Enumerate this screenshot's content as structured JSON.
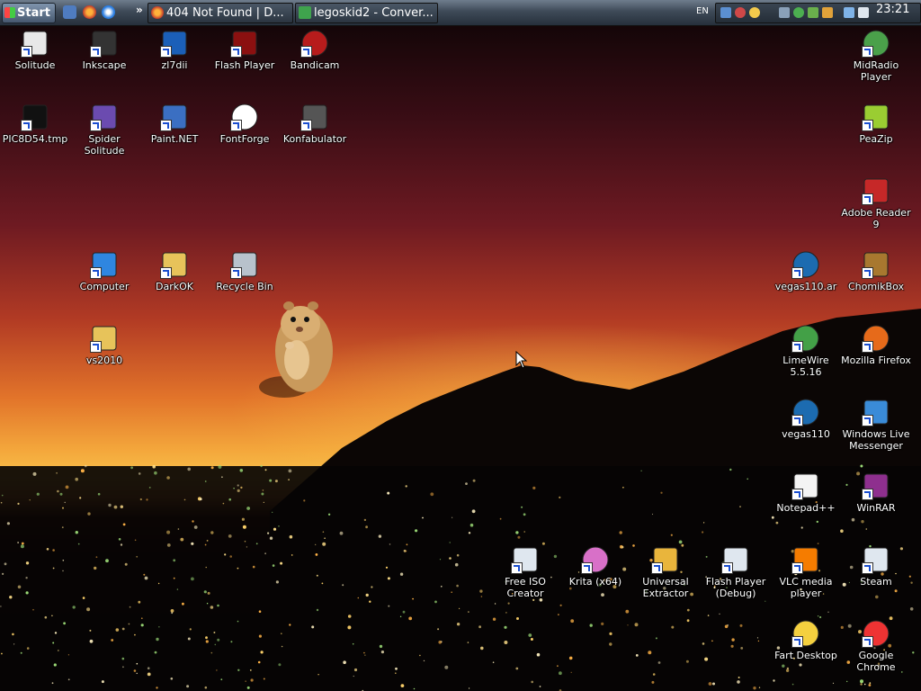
{
  "taskbar": {
    "start_label": "Start",
    "quicklaunch_more": "»",
    "tasks": [
      {
        "label": "404 Not Found | D..."
      },
      {
        "label": "legoskid2 - Conver..."
      }
    ],
    "language": "EN",
    "clock": "23:21"
  },
  "desktop_icons": [
    {
      "label": "Solitude",
      "icon": "solitaire-cards-icon"
    },
    {
      "label": "Inkscape",
      "icon": "inkscape-icon"
    },
    {
      "label": "zl7dii",
      "icon": "flash-shield-icon"
    },
    {
      "label": "Flash Player",
      "icon": "flash-player-icon"
    },
    {
      "label": "Bandicam",
      "icon": "bandicam-icon"
    },
    {
      "label": "PIC8D54.tmp",
      "icon": "tmp-file-icon"
    },
    {
      "label": "Spider Solitude",
      "icon": "spider-solitaire-icon"
    },
    {
      "label": "Paint.NET",
      "icon": "paint-net-icon"
    },
    {
      "label": "FontForge",
      "icon": "fontforge-icon"
    },
    {
      "label": "Konfabulator",
      "icon": "konfabulator-icon"
    },
    {
      "label": "Computer",
      "icon": "computer-icon"
    },
    {
      "label": "DarkOK",
      "icon": "folder-icon"
    },
    {
      "label": "Recycle Bin",
      "icon": "recycle-bin-icon"
    },
    {
      "label": "vs2010",
      "icon": "folder-icon"
    },
    {
      "label": "MidRadio Player",
      "icon": "midradio-icon"
    },
    {
      "label": "PeaZip",
      "icon": "peazip-icon"
    },
    {
      "label": "Adobe Reader 9",
      "icon": "adobe-reader-icon"
    },
    {
      "label": "vegas110.ar",
      "icon": "vegas-icon"
    },
    {
      "label": "ChomikBox",
      "icon": "chomikbox-icon"
    },
    {
      "label": "LimeWire 5.5.16",
      "icon": "limewire-icon"
    },
    {
      "label": "Mozilla Firefox",
      "icon": "firefox-icon"
    },
    {
      "label": "vegas110",
      "icon": "vegas-icon"
    },
    {
      "label": "Windows Live Messenger",
      "icon": "messenger-icon"
    },
    {
      "label": "Notepad++",
      "icon": "notepad-plus-icon"
    },
    {
      "label": "WinRAR",
      "icon": "winrar-icon"
    },
    {
      "label": "Free ISO Creator",
      "icon": "iso-creator-icon"
    },
    {
      "label": "Krita (x64)",
      "icon": "krita-icon"
    },
    {
      "label": "Universal Extractor",
      "icon": "extractor-box-icon"
    },
    {
      "label": "Flash Player (Debug)",
      "icon": "flash-debug-icon"
    },
    {
      "label": "VLC media player",
      "icon": "vlc-cone-icon"
    },
    {
      "label": "Steam",
      "icon": "steam-icon"
    },
    {
      "label": "Fart Desktop",
      "icon": "smiley-icon"
    },
    {
      "label": "Google Chrome",
      "icon": "chrome-icon"
    }
  ]
}
